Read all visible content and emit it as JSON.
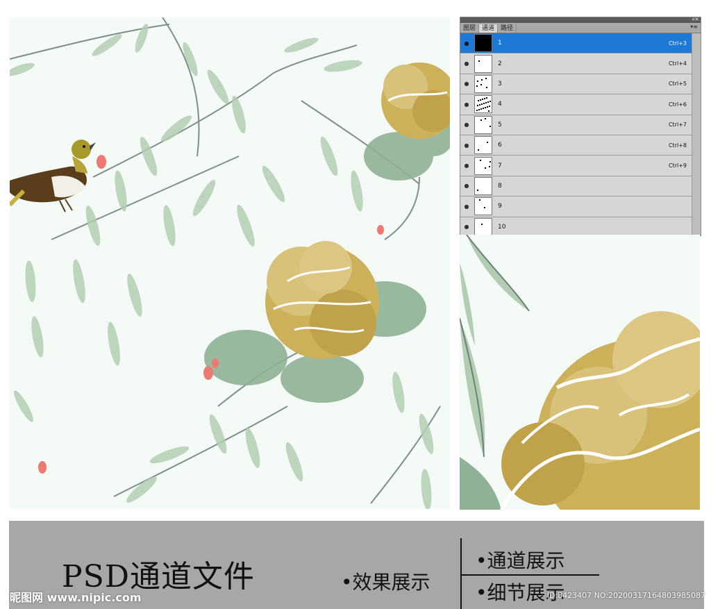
{
  "panel": {
    "tabs": [
      {
        "label": "图层",
        "active": false
      },
      {
        "label": "通道",
        "active": true
      },
      {
        "label": "路径",
        "active": false
      }
    ],
    "collapse_glyph": "«",
    "close_glyph": "×",
    "menu_glyph": "▾≡",
    "eye_glyph": "●",
    "selected_color": "#1d79d6",
    "channels": [
      {
        "name": "1",
        "shortcut": "Ctrl+3",
        "selected": true
      },
      {
        "name": "2",
        "shortcut": "Ctrl+4",
        "selected": false
      },
      {
        "name": "3",
        "shortcut": "Ctrl+5",
        "selected": false
      },
      {
        "name": "4",
        "shortcut": "Ctrl+6",
        "selected": false
      },
      {
        "name": "5",
        "shortcut": "Ctrl+7",
        "selected": false
      },
      {
        "name": "6",
        "shortcut": "Ctrl+8",
        "selected": false
      },
      {
        "name": "7",
        "shortcut": "Ctrl+9",
        "selected": false
      },
      {
        "name": "8",
        "shortcut": "",
        "selected": false
      },
      {
        "name": "9",
        "shortcut": "",
        "selected": false
      },
      {
        "name": "10",
        "shortcut": "",
        "selected": false
      }
    ]
  },
  "footer": {
    "title": "PSD通道文件",
    "effect": "•效果展示",
    "channel": "•通道展示",
    "detail": "•细节展示"
  },
  "watermark": {
    "logo": "昵图网 www.nipic.com",
    "id": "ID:8423407 NO:20200317164803985087"
  },
  "colors": {
    "background": "#f4faf5",
    "gold": "#cdb15a",
    "leaf": "#a9c6aa",
    "bud": "#ec7a72",
    "footer": "#a7a7a7"
  }
}
